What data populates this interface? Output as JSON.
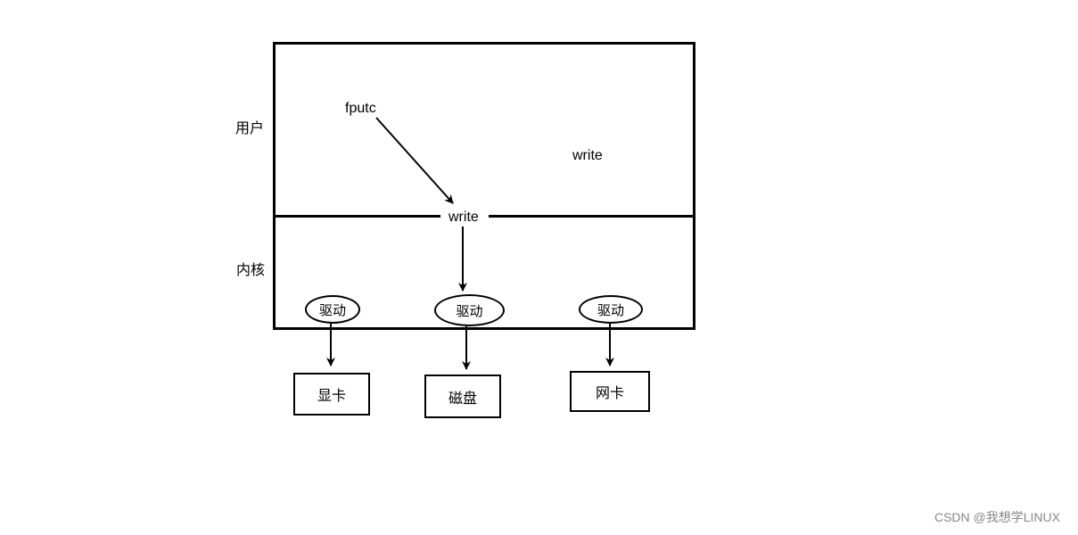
{
  "labels": {
    "user": "用户",
    "kernel": "内核",
    "fputc": "fputc",
    "write_top": "write",
    "write_mid": "write"
  },
  "drivers": {
    "d1": "驱动",
    "d2": "驱动",
    "d3": "驱动"
  },
  "devices": {
    "gpu": "显卡",
    "disk": "磁盘",
    "nic": "网卡"
  },
  "watermark": "CSDN @我想学LINUX"
}
